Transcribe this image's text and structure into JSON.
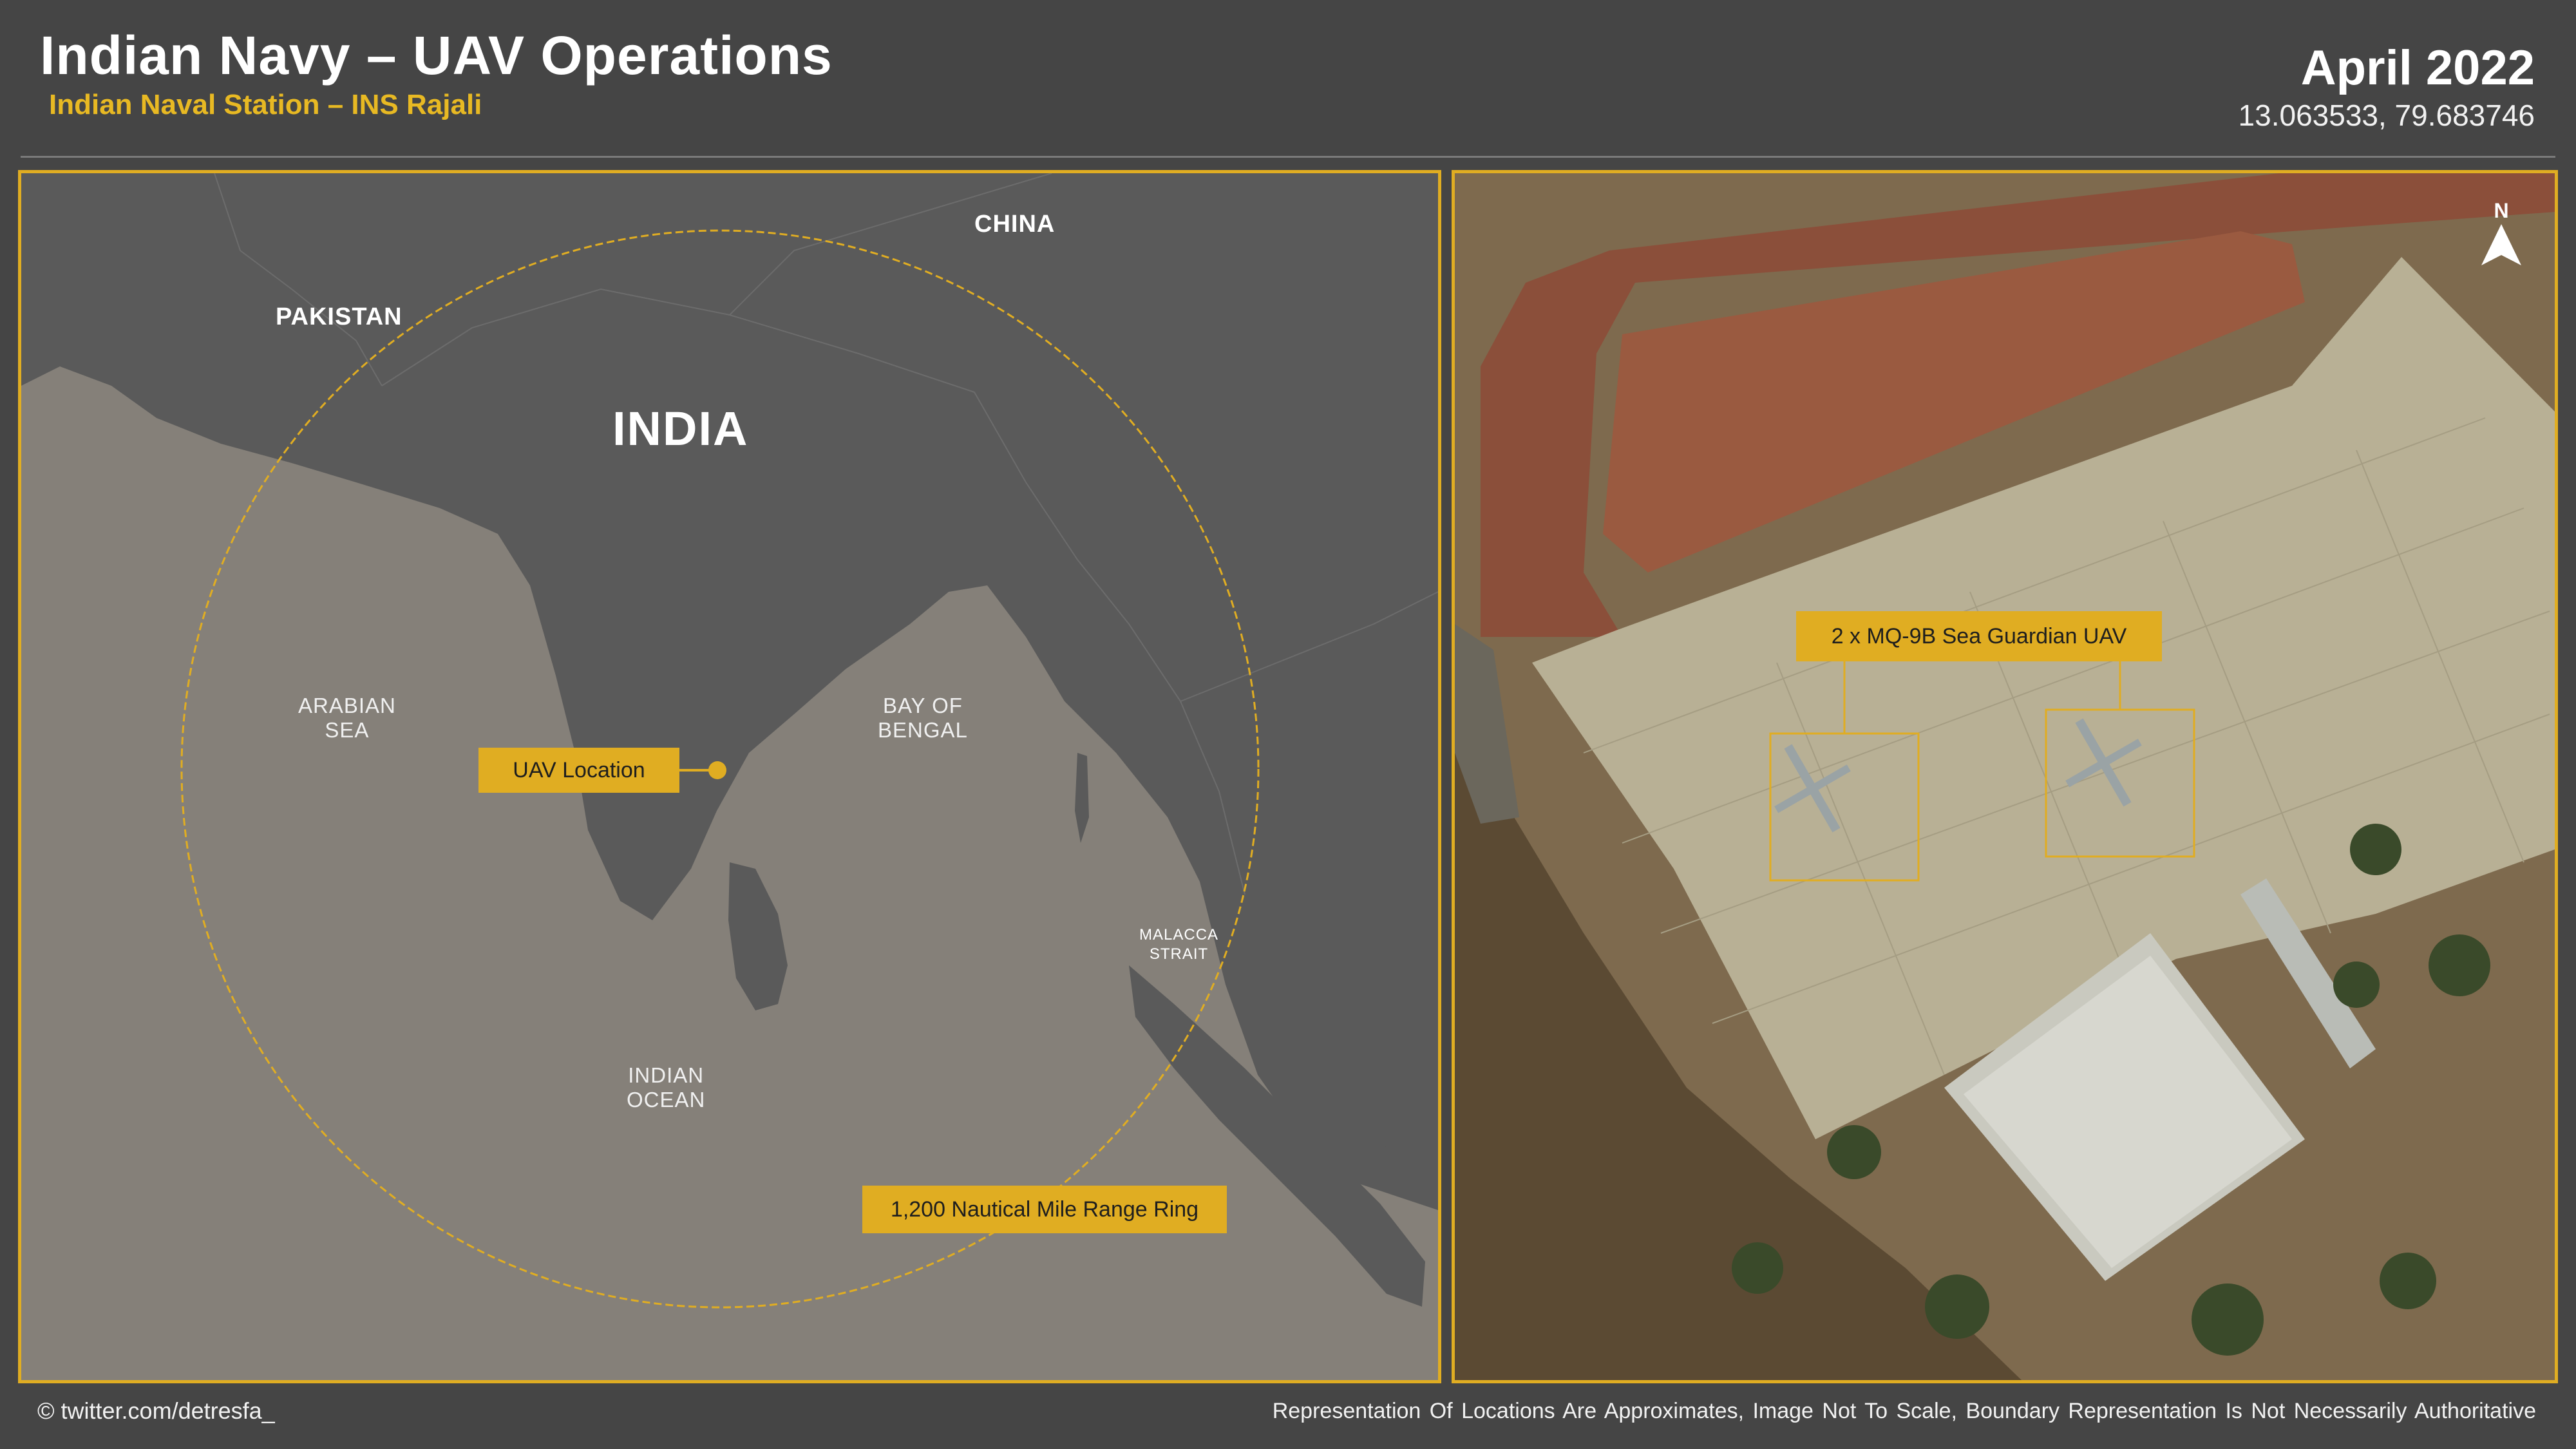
{
  "header": {
    "title": "Indian Navy – UAV Operations",
    "subtitle": "Indian Naval Station – INS Rajali",
    "date": "April 2022",
    "coordinates": "13.063533, 79.683746"
  },
  "map": {
    "countries": {
      "china": "CHINA",
      "pakistan": "PAKISTAN",
      "india": "INDIA"
    },
    "seas": {
      "arabian": [
        "ARABIAN",
        "SEA"
      ],
      "bengal": [
        "BAY OF",
        "BENGAL"
      ],
      "indian": [
        "INDIAN",
        "OCEAN"
      ],
      "malacca": [
        "MALACCA",
        "STRAIT"
      ]
    },
    "uav_label": "UAV Location",
    "range_label": "1,200 Nautical Mile Range Ring"
  },
  "satellite": {
    "callout": "2 x MQ-9B Sea Guardian UAV",
    "north": "N"
  },
  "footer": {
    "credit": "© twitter.com/detresfa_",
    "disclaimer": "Representation Of Locations Are Approximates, Image Not To Scale, Boundary Representation Is Not Necessarily Authoritative"
  },
  "colors": {
    "accent": "#e0ad22",
    "background": "#454545",
    "land": "#5a5a5a",
    "sea": "#858079"
  }
}
